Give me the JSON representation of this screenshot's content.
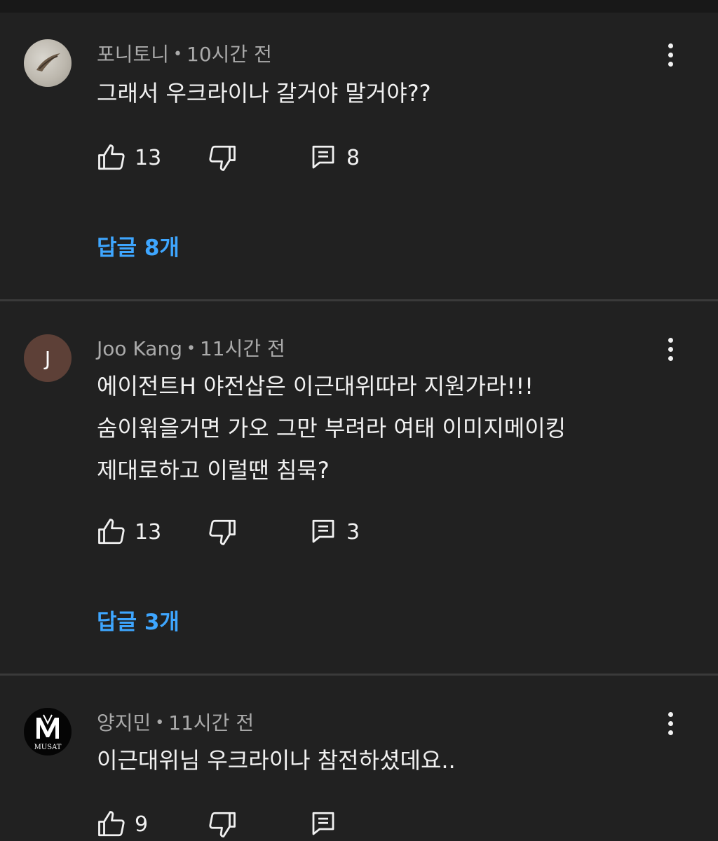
{
  "comments": [
    {
      "author": "포니토니",
      "time": "10시간 전",
      "text": "그래서 우크라이나 갈거야 말거야??",
      "likes": "13",
      "reply_count": "8",
      "replies_label": "답글 8개",
      "avatar": "photo"
    },
    {
      "author": "Joo Kang",
      "time": "11시간 전",
      "text": "에이전트H 야전삽은 이근대위따라 지원가라!!!\n숨이윆을거면 가오 그만 부려라 여태 이미지메이킹\n제대로하고 이럴땐 침묵?",
      "likes": "13",
      "reply_count": "3",
      "replies_label": "답글 3개",
      "avatar_letter": "J",
      "avatar_color": "#5d4037"
    },
    {
      "author": "양지민",
      "time": "11시간 전",
      "text": "이근대위님 우크라이나 참전하셨데요..",
      "likes": "9",
      "reply_count": "",
      "avatar_logo_text": "MUSAT"
    }
  ],
  "separator": "•",
  "icons": {
    "like": "thumbs-up-icon",
    "dislike": "thumbs-down-icon",
    "reply": "comment-icon",
    "more": "more-vert-icon"
  },
  "colors": {
    "background": "#212121",
    "link": "#3ea6ff",
    "meta": "#aaaaaa"
  }
}
